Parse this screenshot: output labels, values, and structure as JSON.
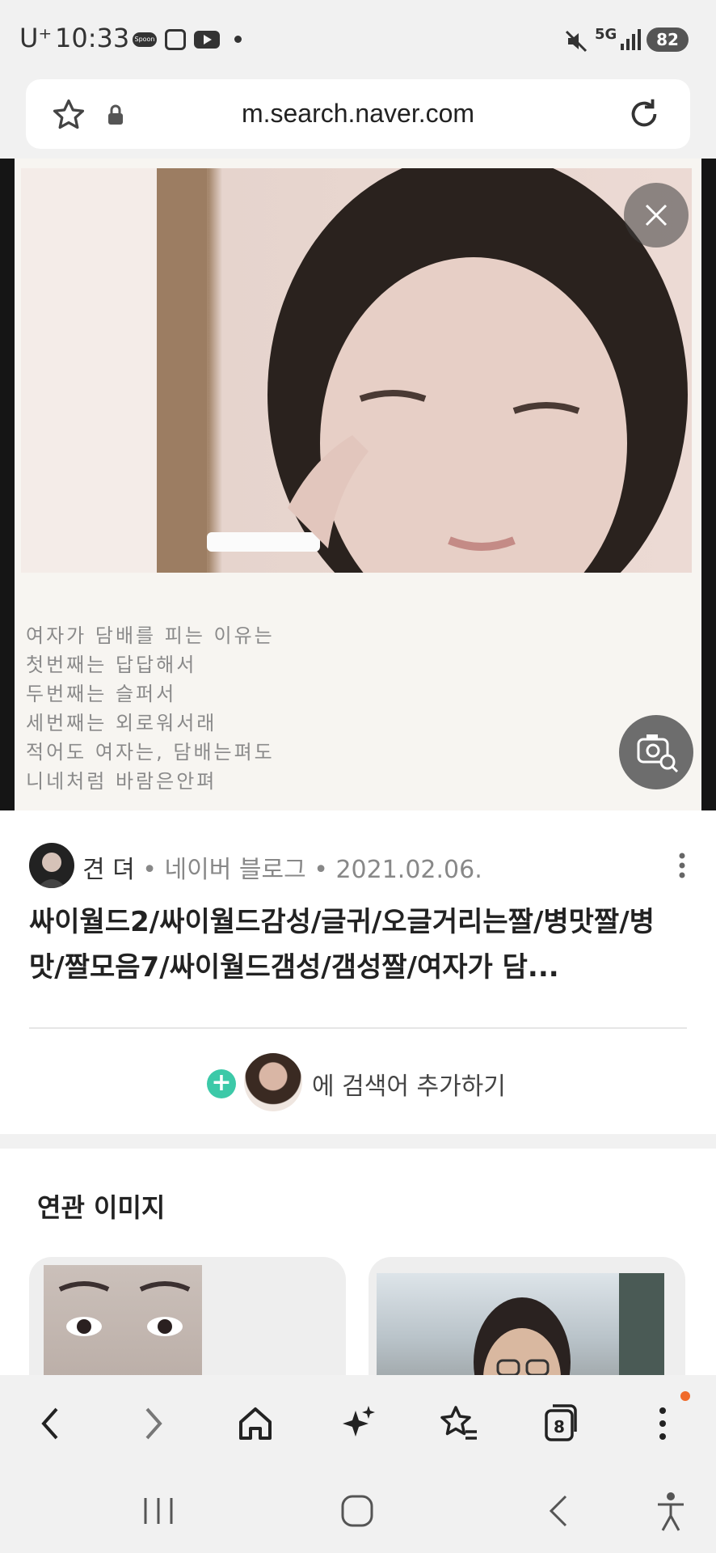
{
  "status_bar": {
    "carrier": "U⁺",
    "time": "10:33",
    "app_badge": "Spoon",
    "network": "5G",
    "battery": "82"
  },
  "url_bar": {
    "url": "m.search.naver.com"
  },
  "image_viewer": {
    "caption_lines": [
      "여자가 담배를 피는 이유는",
      "첫번째는 답답해서",
      "두번째는 슬퍼서",
      "세번째는 외로워서래",
      "적어도 여자는, 담배는펴도",
      "니네처럼 바람은안펴"
    ]
  },
  "result": {
    "author": "견 뎌",
    "source": "네이버 블로그",
    "date": "2021.02.06.",
    "title": "싸이월드2/싸이월드감성/글귀/오글거리는짤/병맛짤/병맛/짤모음7/싸이월드갬성/갬성짤/여자가 담...",
    "add_search_label": "에 검색어 추가하기"
  },
  "related": {
    "title": "연관 이미지"
  },
  "toolbar": {
    "tabs_count": "8"
  },
  "colors": {
    "accent_green": "#3cc9a8",
    "badge_orange": "#f06a2a"
  }
}
